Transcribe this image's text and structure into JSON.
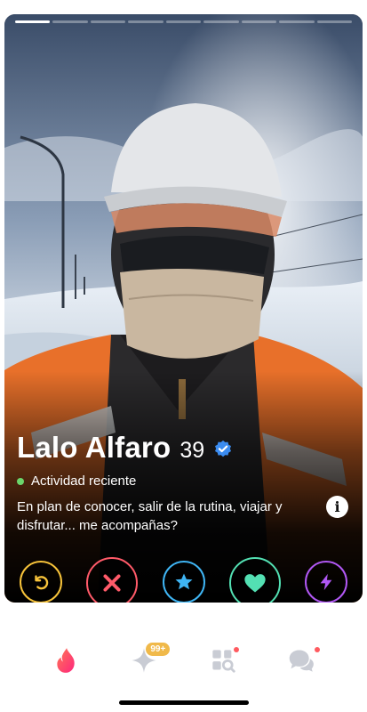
{
  "profile": {
    "name": "Lalo Alfaro",
    "age": "39",
    "activity": "Actividad reciente",
    "bio": "En plan de conocer, salir de la rutina, viajar y disfrutar... me acompañas?",
    "photo_count": 9,
    "active_photo_index": 0
  },
  "actions": {
    "rewind": "rewind-icon",
    "nope": "close-icon",
    "super_like": "star-icon",
    "like": "heart-icon",
    "boost": "lightning-icon"
  },
  "nav": {
    "likes_badge": "99+"
  },
  "colors": {
    "rewind": "#f7c33a",
    "nope": "#ff5a69",
    "super_like": "#3fb5f4",
    "like": "#53e0b3",
    "boost": "#b158f4",
    "accent": "#fd5068",
    "online": "#6bd66b"
  }
}
